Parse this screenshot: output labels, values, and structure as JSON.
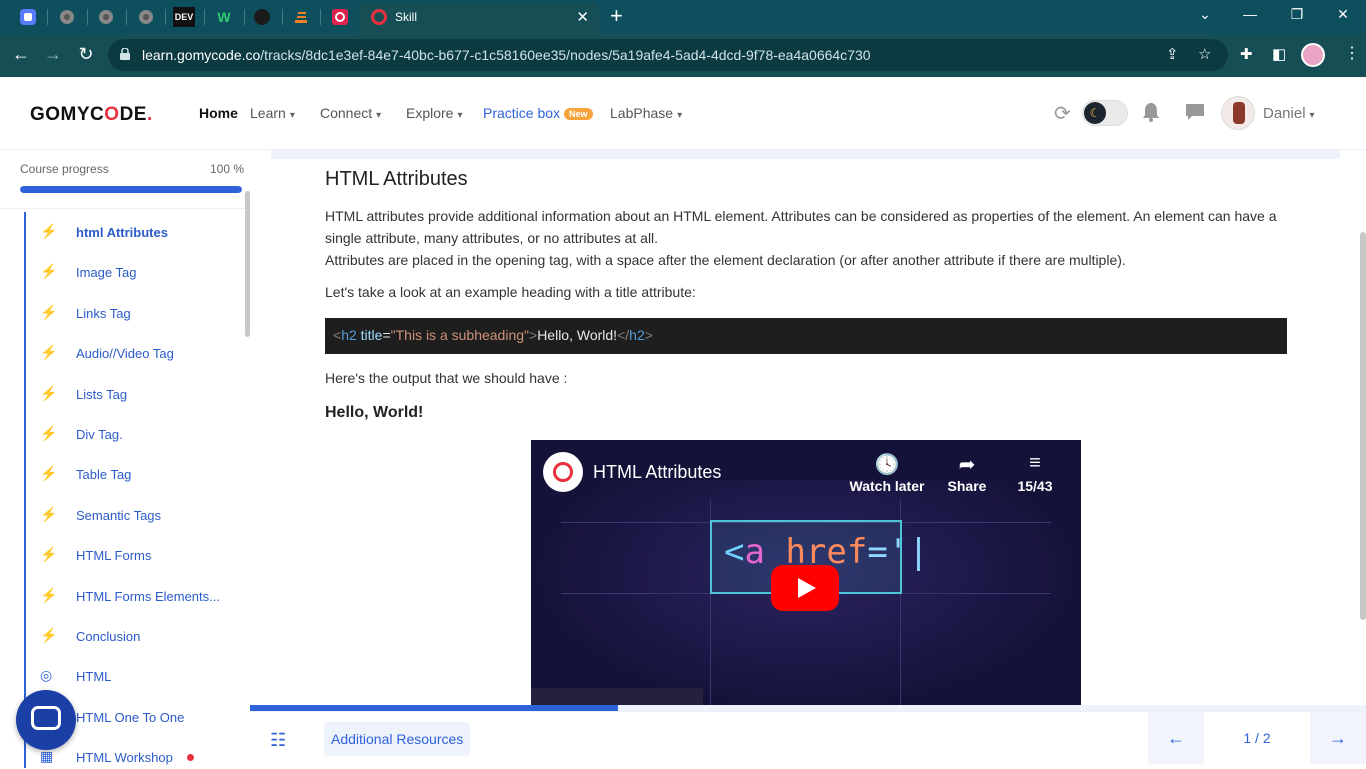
{
  "browser": {
    "active_tab_title": "Skill",
    "tab_labels": [
      "DEV",
      "W"
    ],
    "url_host": "learn.gomycode.co",
    "url_path": "/tracks/8dc1e3ef-84e7-40bc-b677-c1c58160ee35/nodes/5a19afe4-5ad4-4dcd-9f78-ea4a0664c730",
    "new_tab": "+",
    "tab_close": "✕"
  },
  "header": {
    "logo_left": "GOMYC",
    "logo_o": "O",
    "logo_right": "DE",
    "logo_mark": ".",
    "menu": {
      "home": "Home",
      "learn": "Learn",
      "connect": "Connect",
      "explore": "Explore",
      "practice": "Practice box",
      "practice_badge": "New",
      "labphase": "LabPhase"
    },
    "user_name": "Daniel"
  },
  "sidebar": {
    "progress_label": "Course progress",
    "progress_pct_text": "100 %",
    "progress_value": 1.0,
    "lessons": [
      {
        "label": "html Attributes",
        "icon": "bolt-icon",
        "active": true
      },
      {
        "label": "Image Tag",
        "icon": "bolt-icon"
      },
      {
        "label": "Links Tag",
        "icon": "bolt-icon"
      },
      {
        "label": "Audio//Video Tag",
        "icon": "bolt-icon"
      },
      {
        "label": "Lists Tag",
        "icon": "bolt-icon"
      },
      {
        "label": "Div Tag.",
        "icon": "bolt-icon"
      },
      {
        "label": "Table Tag",
        "icon": "bolt-icon"
      },
      {
        "label": "Semantic Tags",
        "icon": "bolt-icon"
      },
      {
        "label": "HTML Forms",
        "icon": "bolt-icon"
      },
      {
        "label": "HTML Forms Elements...",
        "icon": "bolt-icon"
      },
      {
        "label": "Conclusion",
        "icon": "bolt-icon"
      },
      {
        "label": "HTML",
        "icon": "target-icon"
      },
      {
        "label": "HTML One To One",
        "icon": "people-icon"
      },
      {
        "label": "HTML Workshop",
        "icon": "workshop-icon"
      }
    ]
  },
  "content": {
    "title": "HTML Attributes",
    "para1": "HTML attributes provide additional information about an HTML element. Attributes can be considered as properties of the element. An element can have a single attribute, many attributes, or no attributes at all.",
    "para1b": "Attributes are placed in the opening tag, with a space after the element declaration (or after another attribute if there are multiple).",
    "para2": "Let's take a look at an example heading with a title attribute:",
    "code": {
      "lt": "<",
      "tag": "h2",
      "attr": "title",
      "eq": "=",
      "str": "\"This is a subheading\"",
      "gt": ">",
      "text": "Hello, World!",
      "close_lt": "</",
      "close_tag": "h2",
      "close_gt": ">"
    },
    "para3": "Here's the output that we should have :",
    "output_heading": "Hello, World!",
    "video": {
      "title": "HTML Attributes",
      "watch_later": "Watch later",
      "share": "Share",
      "playlist_count": "15/43",
      "code_lt": "<",
      "code_a": "a",
      "code_href": "href",
      "code_eq": "='",
      "code_tail": "|"
    }
  },
  "footer": {
    "additional_resources": "Additional Resources",
    "page_indicator": "1 / 2",
    "slide_progress": 0.33
  },
  "colors": {
    "accent": "#2e62d9",
    "brand_red": "#e8313c",
    "chrome_teal": "#164e56"
  }
}
